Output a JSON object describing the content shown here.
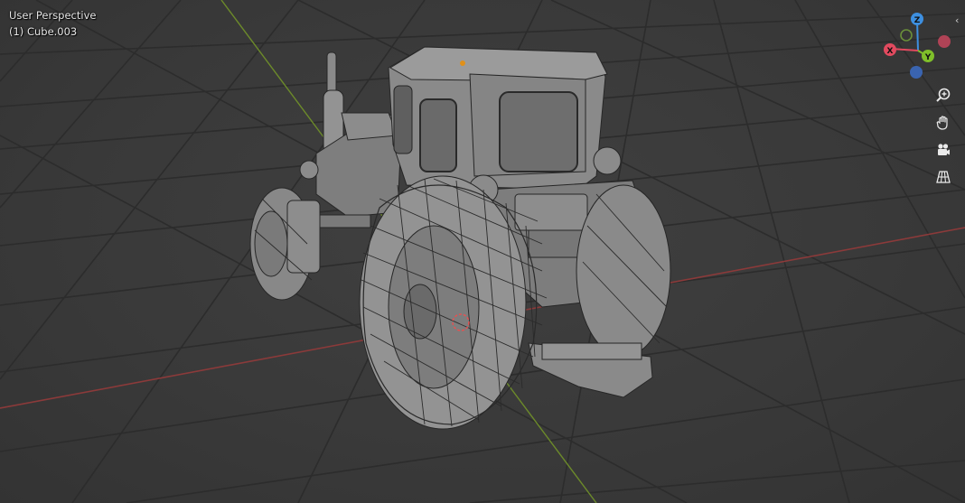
{
  "viewport": {
    "view_name": "User Perspective",
    "object_name": "(1) Cube.003"
  },
  "gizmo": {
    "z_label": "Z",
    "x_label": "X",
    "y_label": "Y",
    "colors": {
      "x": "#e24a5f",
      "y": "#7fbf2a",
      "z": "#3d8fe0",
      "neg_x": "#b04356",
      "neg_y": "#6a8f3a",
      "neg_z": "#3a64b0"
    }
  },
  "navigation_tools": [
    {
      "name": "zoom",
      "icon": "zoom-in-icon"
    },
    {
      "name": "pan",
      "icon": "hand-icon"
    },
    {
      "name": "camera",
      "icon": "camera-icon"
    },
    {
      "name": "perspective",
      "icon": "grid-perspective-icon"
    }
  ],
  "colors": {
    "background": "#3a3a3a",
    "grid": "#2b2b2b",
    "x_axis": "#9a3b3b",
    "y_axis": "#6f8a2b",
    "model": "#9a9a9a"
  }
}
